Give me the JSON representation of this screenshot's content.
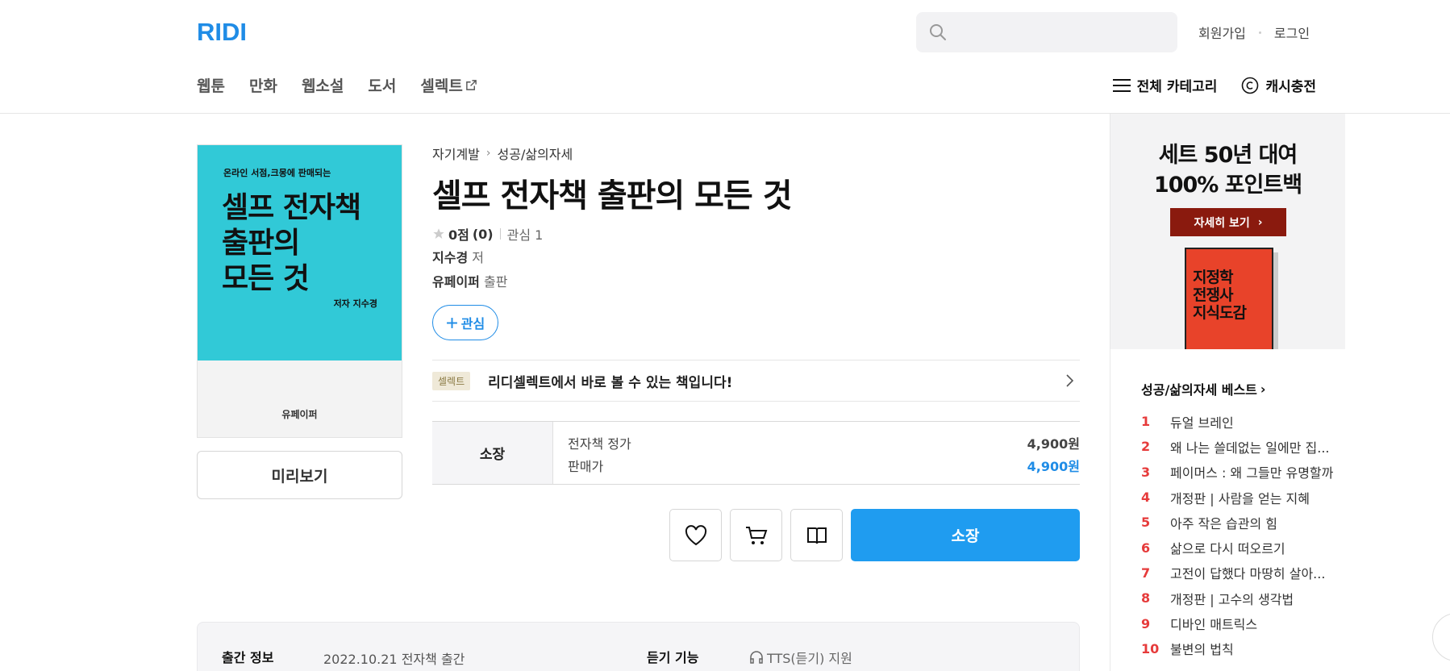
{
  "header": {
    "logo": "RIDI",
    "search_placeholder": "",
    "signup": "회원가입",
    "login": "로그인"
  },
  "nav": {
    "items": [
      "웹툰",
      "만화",
      "웹소설",
      "도서",
      "셀렉트"
    ],
    "all_categories": "전체 카테고리",
    "cash_charge": "캐시충전"
  },
  "cover": {
    "subtitle": "온라인 서점,크몽에 판매되는",
    "title_line1": "셀프 전자책",
    "title_line2": "출판의",
    "title_line3": "모든 것",
    "author": "저자 지수경",
    "publisher": "유페이퍼",
    "color": "#31c9d7"
  },
  "preview_button": "미리보기",
  "book": {
    "breadcrumb": [
      "자기계발",
      "성공/삶의자세"
    ],
    "title": "셀프 전자책 출판의 모든 것",
    "score": "0점",
    "score_count": "(0)",
    "interest": "관심 1",
    "author_name": "지수경",
    "author_suffix": " 저",
    "publisher_name": "유페이퍼",
    "publisher_suffix": " 출판",
    "fav_button": "관심"
  },
  "select": {
    "badge": "셀렉트",
    "text": "리디셀렉트에서 바로 볼 수 있는 책입니다!"
  },
  "price": {
    "type": "소장",
    "list_label": "전자책 정가",
    "list_value": "4,900원",
    "sale_label": "판매가",
    "sale_value": "4,900원"
  },
  "actions": {
    "buy": "소장",
    "icons": [
      "heart-icon",
      "cart-icon",
      "gift-icon"
    ]
  },
  "pubinfo": {
    "label1": "출간 정보",
    "value1": "2022.10.21 전자책 출간",
    "label2": "듣기 기능",
    "value2": "TTS(듣기) 지원"
  },
  "ad": {
    "headline1": "세트 50년 대여",
    "headline2": "100% 포인트백",
    "cta": "자세히 보기",
    "book_line1": "지정학",
    "book_line2": "전쟁사",
    "book_line3": "지식도감"
  },
  "best": {
    "title": "성공/삶의자세 베스트",
    "items": [
      {
        "rank": "1",
        "name": "듀얼 브레인"
      },
      {
        "rank": "2",
        "name": "왜 나는 쓸데없는 일에만 집..."
      },
      {
        "rank": "3",
        "name": "페이머스 : 왜 그들만 유명할까"
      },
      {
        "rank": "4",
        "name": "개정판 | 사람을 얻는 지혜"
      },
      {
        "rank": "5",
        "name": "아주 작은 습관의 힘"
      },
      {
        "rank": "6",
        "name": "삶으로 다시 떠오르기"
      },
      {
        "rank": "7",
        "name": "고전이 답했다 마땅히 살아..."
      },
      {
        "rank": "8",
        "name": "개정판 | 고수의 생각법"
      },
      {
        "rank": "9",
        "name": "디바인 매트릭스"
      },
      {
        "rank": "10",
        "name": "불변의 법칙"
      }
    ]
  },
  "colors": {
    "accent": "#1f8ce6",
    "buy_button": "#1f9cf0",
    "rank": "#e63b3b"
  }
}
